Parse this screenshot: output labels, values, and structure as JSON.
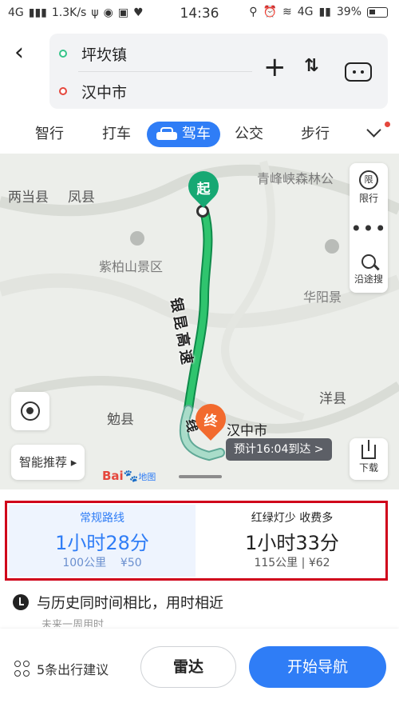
{
  "status_bar": {
    "network_left": "4G",
    "speed": "1.3K/s",
    "time": "14:36",
    "network_right": "4G",
    "battery": "39%"
  },
  "route": {
    "origin": "坪坎镇",
    "destination": "汉中市"
  },
  "tabs": [
    {
      "label": "智行"
    },
    {
      "label": "打车"
    },
    {
      "label": "驾车"
    },
    {
      "label": "公交"
    },
    {
      "label": "步行"
    }
  ],
  "active_tab": "驾车",
  "map": {
    "places": {
      "liangdang": "两当县",
      "fengxian": "凤县",
      "qingfengxia": "青峰峡森林公",
      "zibaishan": "紫柏山景区",
      "huayang": "华阳景",
      "mianxian": "勉县",
      "yangxian": "洋县",
      "hanzhong": "汉中市"
    },
    "road_name": "银昆高速",
    "road_suffix": "线",
    "start_pin": "起",
    "end_pin": "终",
    "eta": "预计16:04到达 >",
    "logo": "Bai地图",
    "side_buttons": {
      "limit": "限行",
      "limit_glyph": "限",
      "more": "•••",
      "search_along": "沿途搜",
      "download": "下载"
    },
    "smart_recommend": "智能推荐 ▸"
  },
  "routes": [
    {
      "tag": "常规路线",
      "duration": "1小时28分",
      "distance": "100公里",
      "cost": "¥50"
    },
    {
      "tag": "红绿灯少  收费多",
      "duration": "1小时33分",
      "distance": "115公里",
      "cost": "¥62"
    }
  ],
  "tip": {
    "text": "与历史同时间相比，用时相近",
    "sub": "未来一周用时"
  },
  "actions": {
    "suggestions": "5条出行建议",
    "radar": "雷达",
    "navigate": "开始导航"
  },
  "colors": {
    "accent": "#2f7df6",
    "route_green": "#16a873",
    "highlight_box": "#d0021b"
  }
}
